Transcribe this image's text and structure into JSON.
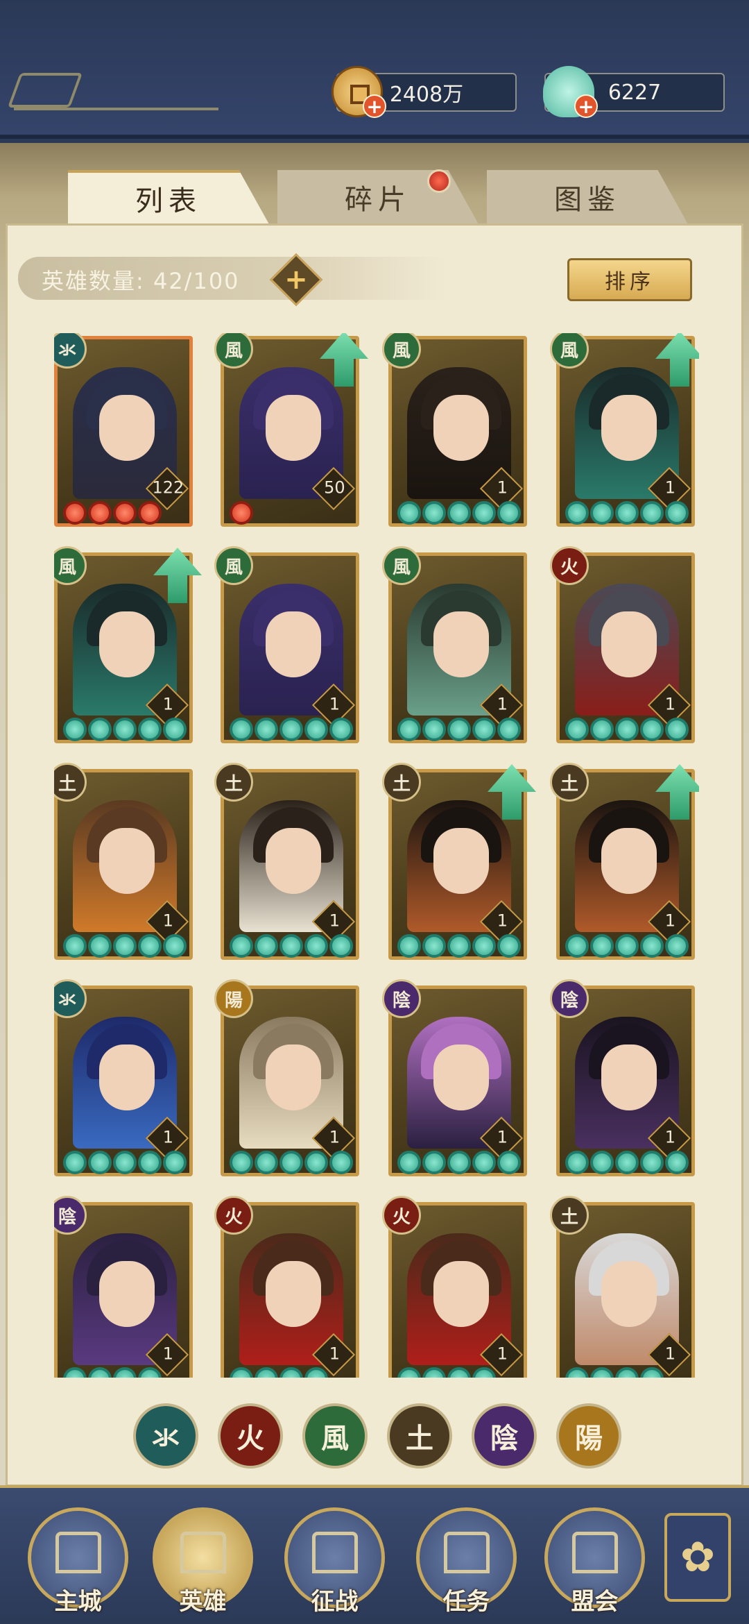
{
  "currencies": {
    "coins": "2408万",
    "jade": "6227"
  },
  "tabs": [
    {
      "label": "列表",
      "active": true
    },
    {
      "label": "碎片",
      "active": false,
      "has_dot": true
    },
    {
      "label": "图鉴",
      "active": false
    }
  ],
  "hero_count": {
    "label": "英雄数量: 42/100"
  },
  "sort_label": "排序",
  "elements": {
    "water": {
      "glyph": "氺",
      "color": "#1f5c5a"
    },
    "fire": {
      "glyph": "火",
      "color": "#7a1e14"
    },
    "wind": {
      "glyph": "風",
      "color": "#2e6b3a"
    },
    "earth": {
      "glyph": "土",
      "color": "#4a3a22"
    },
    "yin": {
      "glyph": "陰",
      "color": "#4a2a6a"
    },
    "yang": {
      "glyph": "陽",
      "color": "#a8761c"
    }
  },
  "heroes": [
    {
      "element": "water",
      "level": "122",
      "stars": 4,
      "star_color": "red",
      "upgrade": false,
      "frame": "orange",
      "palette": [
        "#2a2f4a",
        "#2a2a3a"
      ]
    },
    {
      "element": "wind",
      "level": "50",
      "stars": 1,
      "star_color": "red",
      "upgrade": true,
      "frame": "gold",
      "palette": [
        "#3a2f6a",
        "#2a2250"
      ]
    },
    {
      "element": "wind",
      "level": "1",
      "stars": 5,
      "star_color": "green",
      "upgrade": false,
      "frame": "gold",
      "palette": [
        "#2a221a",
        "#1a1410"
      ]
    },
    {
      "element": "wind",
      "level": "1",
      "stars": 5,
      "star_color": "green",
      "upgrade": true,
      "frame": "gold",
      "palette": [
        "#1a2a2a",
        "#2a7a6a"
      ]
    },
    {
      "element": "wind",
      "level": "1",
      "stars": 5,
      "star_color": "green",
      "upgrade": true,
      "frame": "gold",
      "palette": [
        "#1a2a2a",
        "#2a7a6a"
      ]
    },
    {
      "element": "wind",
      "level": "1",
      "stars": 5,
      "star_color": "green",
      "upgrade": false,
      "frame": "gold",
      "palette": [
        "#3a2f6a",
        "#2a2250"
      ]
    },
    {
      "element": "wind",
      "level": "1",
      "stars": 5,
      "star_color": "green",
      "upgrade": false,
      "frame": "gold",
      "palette": [
        "#2a3a30",
        "#6aa08a"
      ]
    },
    {
      "element": "fire",
      "level": "1",
      "stars": 5,
      "star_color": "green",
      "upgrade": false,
      "frame": "gold",
      "palette": [
        "#4a4a55",
        "#8a1e1a"
      ]
    },
    {
      "element": "earth",
      "level": "1",
      "stars": 5,
      "star_color": "green",
      "upgrade": false,
      "frame": "gold",
      "palette": [
        "#5a3a22",
        "#d07a2a"
      ]
    },
    {
      "element": "earth",
      "level": "1",
      "stars": 5,
      "star_color": "green",
      "upgrade": false,
      "frame": "gold",
      "palette": [
        "#2a221a",
        "#e8e2d2"
      ]
    },
    {
      "element": "earth",
      "level": "1",
      "stars": 5,
      "star_color": "green",
      "upgrade": true,
      "frame": "gold",
      "palette": [
        "#1a1410",
        "#b05a2a"
      ]
    },
    {
      "element": "earth",
      "level": "1",
      "stars": 5,
      "star_color": "green",
      "upgrade": true,
      "frame": "gold",
      "palette": [
        "#1a1410",
        "#b05a2a"
      ]
    },
    {
      "element": "water",
      "level": "1",
      "stars": 5,
      "star_color": "green",
      "upgrade": false,
      "frame": "gold",
      "palette": [
        "#1e2a6a",
        "#3a6ac0"
      ]
    },
    {
      "element": "yang",
      "level": "1",
      "stars": 5,
      "star_color": "green",
      "upgrade": false,
      "frame": "gold",
      "palette": [
        "#8a7a60",
        "#e8dcc0"
      ]
    },
    {
      "element": "yin",
      "level": "1",
      "stars": 5,
      "star_color": "green",
      "upgrade": false,
      "frame": "gold",
      "palette": [
        "#b070c0",
        "#2a2040"
      ]
    },
    {
      "element": "yin",
      "level": "1",
      "stars": 5,
      "star_color": "green",
      "upgrade": false,
      "frame": "gold",
      "palette": [
        "#1a1420",
        "#4a3060"
      ]
    },
    {
      "element": "yin",
      "level": "1",
      "stars": 4,
      "star_color": "green",
      "upgrade": false,
      "frame": "gold",
      "palette": [
        "#2a2040",
        "#5a3a80"
      ]
    },
    {
      "element": "fire",
      "level": "1",
      "stars": 4,
      "star_color": "green",
      "upgrade": false,
      "frame": "gold",
      "palette": [
        "#4a2a1a",
        "#b01e1a"
      ]
    },
    {
      "element": "fire",
      "level": "1",
      "stars": 4,
      "star_color": "green",
      "upgrade": false,
      "frame": "gold",
      "palette": [
        "#4a2a1a",
        "#b01e1a"
      ]
    },
    {
      "element": "earth",
      "level": "1",
      "stars": 4,
      "star_color": "green",
      "upgrade": false,
      "frame": "gold",
      "palette": [
        "#d8d8d8",
        "#c08a6a"
      ]
    }
  ],
  "filters": [
    "water",
    "fire",
    "wind",
    "earth",
    "yin",
    "yang"
  ],
  "nav": [
    {
      "label": "主城",
      "icon": "city-gate-icon",
      "active": false
    },
    {
      "label": "英雄",
      "icon": "hero-portrait-icon",
      "active": true
    },
    {
      "label": "征战",
      "icon": "battle-banner-icon",
      "active": false
    },
    {
      "label": "任务",
      "icon": "quest-scroll-icon",
      "active": false
    },
    {
      "label": "盟会",
      "icon": "alliance-hall-icon",
      "active": false
    }
  ],
  "more_icon": "clover-menu-icon"
}
